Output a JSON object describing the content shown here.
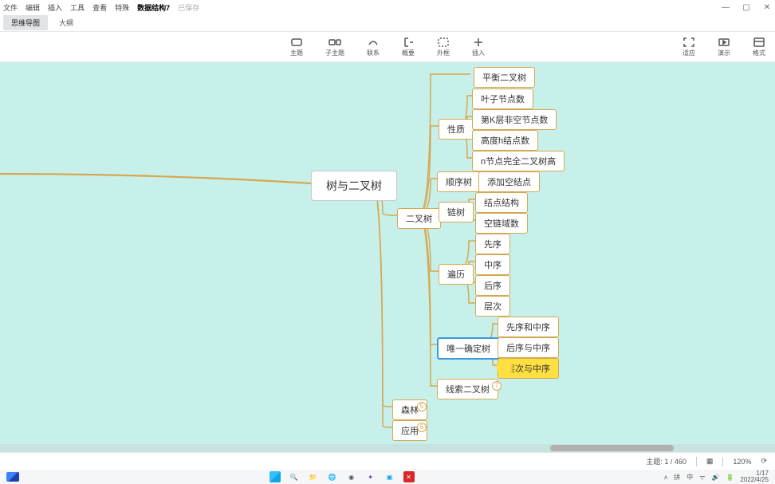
{
  "menu": {
    "file": "文件",
    "edit": "编辑",
    "insert": "插入",
    "tool": "工具",
    "view": "查看",
    "special": "特殊",
    "doc_title": "数据结构7",
    "saved": "已保存"
  },
  "window_controls": {
    "min": "—",
    "max": "▢",
    "close": "✕"
  },
  "tabs": {
    "mindmap": "思维导图",
    "outline": "大纲"
  },
  "toolbar": {
    "topic": "主题",
    "subtopic": "子主题",
    "link": "联系",
    "summary": "概要",
    "boundary": "外框",
    "insert": "插入",
    "fit": "适应",
    "present": "演示",
    "format": "格式"
  },
  "nodes": {
    "root": "树与二叉树",
    "balanced": "平衡二叉树",
    "prop": "性质",
    "prop_leaf": "叶子节点数",
    "prop_k": "第K层非空节点数",
    "prop_h": "高度h结点数",
    "prop_n": "n节点完全二叉树高",
    "seq": "顺序树",
    "seq_add": "添加空结点",
    "bin": "二叉树",
    "chain": "链树",
    "chain_node": "结点结构",
    "chain_null": "空链域数",
    "trav": "遍历",
    "trav_pre": "先序",
    "trav_in": "中序",
    "trav_post": "后序",
    "trav_level": "层次",
    "uniq": "唯一确定树",
    "uniq_pi": "先序和中序",
    "uniq_po": "后序与中序",
    "uniq_li": "层次与中序",
    "thread": "线索二叉树",
    "forest": "森林",
    "app": "应用"
  },
  "collapse_counts": {
    "thread": "7",
    "forest": "5",
    "app": "6"
  },
  "status": {
    "words": "主题: 1 / 460",
    "grid_icon": "▦",
    "zoom": "120%",
    "sync": "⟳"
  },
  "taskbar": {
    "icons": [
      "start",
      "search",
      "explorer",
      "edge",
      "chrome",
      "app1",
      "app2",
      "app3",
      "close"
    ],
    "tray": {
      "up": "ʌ",
      "pin": "拼",
      "ime": "中",
      "wifi": "ᯤ",
      "vol": "🔊",
      "bat": "🔋",
      "line1": "1/17",
      "line2": "2022/4/25"
    }
  },
  "chart_data": {
    "type": "mindmap",
    "title": "树与二叉树",
    "root": {
      "label": "树与二叉树",
      "children": [
        {
          "label": "二叉树",
          "children": [
            {
              "label": "平衡二叉树"
            },
            {
              "label": "性质",
              "children": [
                {
                  "label": "叶子节点数"
                },
                {
                  "label": "第K层非空节点数"
                },
                {
                  "label": "高度h结点数"
                },
                {
                  "label": "n节点完全二叉树高"
                }
              ]
            },
            {
              "label": "顺序树",
              "children": [
                {
                  "label": "添加空结点"
                }
              ]
            },
            {
              "label": "链树",
              "children": [
                {
                  "label": "结点结构"
                },
                {
                  "label": "空链域数"
                }
              ]
            },
            {
              "label": "遍历",
              "children": [
                {
                  "label": "先序"
                },
                {
                  "label": "中序"
                },
                {
                  "label": "后序"
                },
                {
                  "label": "层次"
                }
              ]
            },
            {
              "label": "唯一确定树",
              "selected": true,
              "children": [
                {
                  "label": "先序和中序"
                },
                {
                  "label": "后序与中序"
                },
                {
                  "label": "层次与中序",
                  "highlighted": true
                }
              ]
            },
            {
              "label": "线索二叉树",
              "collapsed_children": 7
            }
          ]
        },
        {
          "label": "森林",
          "collapsed_children": 5
        },
        {
          "label": "应用",
          "collapsed_children": 6
        }
      ]
    }
  }
}
